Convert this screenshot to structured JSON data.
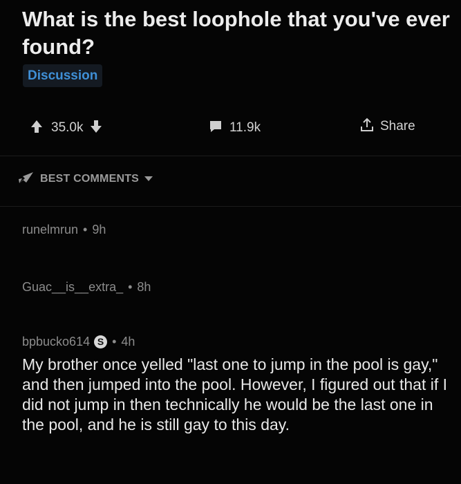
{
  "post": {
    "title": "What is the best loophole that you've ever found?",
    "flair": "Discussion"
  },
  "actions": {
    "upvote_count": "35.0k",
    "comment_count": "11.9k",
    "share_label": "Share"
  },
  "sort": {
    "label": "BEST COMMENTS"
  },
  "comments": [
    {
      "author": "runelmrun",
      "separator": "•",
      "age": "9h"
    },
    {
      "author": "Guac__is__extra_",
      "separator": "•",
      "age": "8h"
    },
    {
      "author": "bpbucko614",
      "badge": "S",
      "separator": "•",
      "age": "4h",
      "body": "My brother once yelled \"last one to jump in the pool is gay,\" and then jumped into the pool. However, I figured out that if I did not jump in then technically he would be the last one in the pool, and he is still gay to this day."
    }
  ]
}
